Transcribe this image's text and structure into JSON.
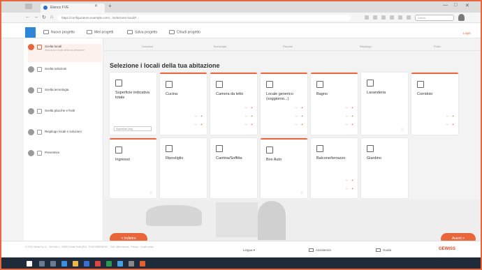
{
  "browser": {
    "tab_title": "Elenco FVE",
    "url": "https://configuratore.example.com/.../selezione-locali?...",
    "search_placeholder": "Cerca"
  },
  "header": {
    "menu": [
      {
        "label": "Nuovo progetto",
        "icon": "plus-icon"
      },
      {
        "label": "Miei progetti",
        "icon": "folder-icon"
      },
      {
        "label": "Salva progetto",
        "icon": "save-icon"
      },
      {
        "label": "Chiudi progetto",
        "icon": "close-icon"
      }
    ],
    "user_link": "Login"
  },
  "sidebar": {
    "steps": [
      {
        "title": "Scelta locali",
        "subtitle": "Seleziona i locali della tua abitazione"
      },
      {
        "title": "Scelta soluzioni",
        "subtitle": ""
      },
      {
        "title": "Scelta tecnologia",
        "subtitle": ""
      },
      {
        "title": "Scelta placche e frutti",
        "subtitle": ""
      },
      {
        "title": "Riepilogo locali e soluzioni",
        "subtitle": ""
      },
      {
        "title": "Preventivo",
        "subtitle": ""
      }
    ]
  },
  "main": {
    "step_labels": [
      "Soluzioni",
      "Tecnologia",
      "Placche",
      "Riepilogo",
      "Finito"
    ],
    "heading": "Selezione i locali della tua abitazione",
    "surface_select": "Superficie (mq)",
    "cards": [
      {
        "title": "Superficie indicativa totale",
        "icon": "cube-icon",
        "selected": false
      },
      {
        "title": "Cucina",
        "icon": "kitchen-icon",
        "selected": true
      },
      {
        "title": "Camera da letto",
        "icon": "bed-icon",
        "selected": true
      },
      {
        "title": "Locale generico (soggiorno...)",
        "icon": "sofa-icon",
        "selected": true
      },
      {
        "title": "Bagno",
        "icon": "bath-icon",
        "selected": true
      },
      {
        "title": "Lavanderia",
        "icon": "washer-icon",
        "selected": false
      },
      {
        "title": "Corridoio",
        "icon": "corridor-icon",
        "selected": true
      },
      {
        "title": "Ingresso",
        "icon": "door-icon",
        "selected": true
      },
      {
        "title": "Ripostiglio",
        "icon": "closet-icon",
        "selected": false
      },
      {
        "title": "Cantina/Soffitta",
        "icon": "attic-icon",
        "selected": false
      },
      {
        "title": "Box Auto",
        "icon": "garage-icon",
        "selected": true
      },
      {
        "title": "Balcone/terrazzo",
        "icon": "balcony-icon",
        "selected": false
      },
      {
        "title": "Giardino",
        "icon": "garden-icon",
        "selected": false
      }
    ],
    "back_button": "< Indietro",
    "next_button": "Avanti >"
  },
  "footer": {
    "legal": "© 2024 Gewiss S.p.A. - Via Volta 1 - 24069 Cenate Sotto (BG) - P.IVA 00385040167 - Tutti i diritti riservati - Privacy - Cookie policy",
    "language": "Lingua",
    "items": [
      "Assistenza",
      "Guida"
    ],
    "brand": "GEWISS"
  },
  "colors": {
    "accent": "#e8663a",
    "brand": "#d94a1f",
    "logo": "#2e86d9"
  }
}
